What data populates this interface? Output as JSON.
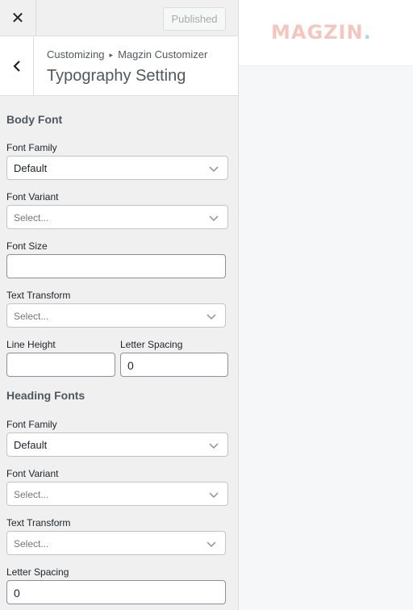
{
  "header": {
    "close_icon": "close-icon",
    "publish_button_label": "Published"
  },
  "section": {
    "breadcrumb_root": "Customizing",
    "breadcrumb_sep": "▸",
    "breadcrumb_parent": "Magzin Customizer",
    "title": "Typography Setting"
  },
  "body_font": {
    "group_title": "Body Font",
    "font_family_label": "Font Family",
    "font_family_value": "Default",
    "font_variant_label": "Font Variant",
    "font_variant_placeholder": "Select...",
    "font_size_label": "Font Size",
    "font_size_value": "",
    "text_transform_label": "Text Transform",
    "text_transform_placeholder": "Select...",
    "line_height_label": "Line Height",
    "line_height_value": "",
    "letter_spacing_label": "Letter Spacing",
    "letter_spacing_value": "0"
  },
  "heading_font": {
    "group_title": "Heading Fonts",
    "font_family_label": "Font Family",
    "font_family_value": "Default",
    "font_variant_label": "Font Variant",
    "font_variant_placeholder": "Select...",
    "text_transform_label": "Text Transform",
    "text_transform_placeholder": "Select...",
    "letter_spacing_label": "Letter Spacing",
    "letter_spacing_value": "0"
  },
  "preview": {
    "logo_main": "MAGZIN",
    "logo_dot": ".",
    "logo_color": "#f3c7bd",
    "logo_dot_color": "#a4dbe6"
  }
}
